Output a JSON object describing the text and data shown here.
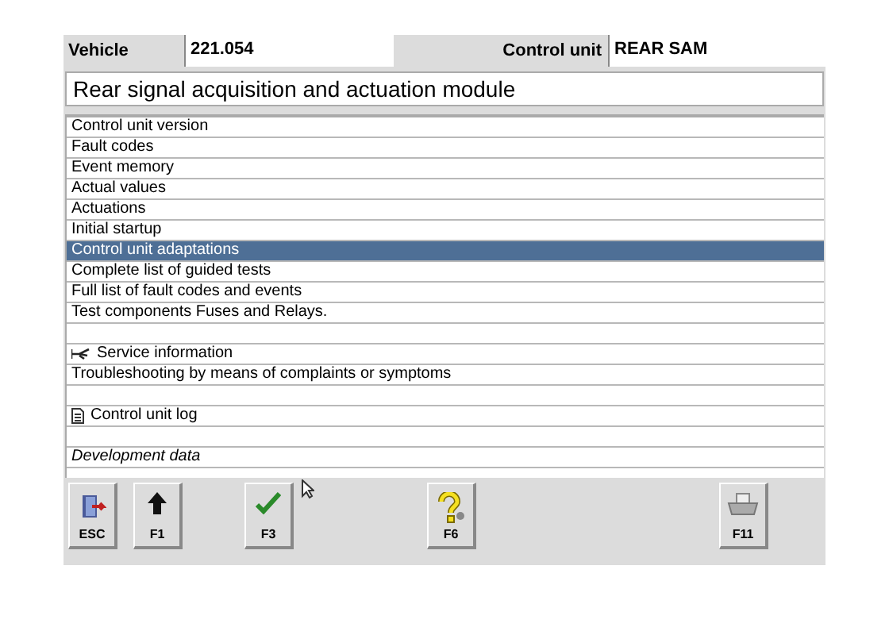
{
  "header": {
    "vehicle_label": "Vehicle",
    "vehicle_value": "221.054",
    "control_unit_label": "Control unit",
    "control_unit_value": "REAR SAM"
  },
  "title": "Rear signal acquisition and actuation module",
  "menu": [
    {
      "kind": "item",
      "label": "Control unit version",
      "selected": false
    },
    {
      "kind": "item",
      "label": "Fault codes",
      "selected": false
    },
    {
      "kind": "item",
      "label": "Event memory",
      "selected": false
    },
    {
      "kind": "item",
      "label": "Actual values",
      "selected": false
    },
    {
      "kind": "item",
      "label": "Actuations",
      "selected": false
    },
    {
      "kind": "item",
      "label": "Initial startup",
      "selected": false
    },
    {
      "kind": "item",
      "label": "Control unit adaptations",
      "selected": true
    },
    {
      "kind": "item",
      "label": "Complete list of guided tests",
      "selected": false
    },
    {
      "kind": "item",
      "label": "Full list of fault codes and events",
      "selected": false
    },
    {
      "kind": "item",
      "label": "Test components Fuses and Relays.",
      "selected": false
    },
    {
      "kind": "spacer"
    },
    {
      "kind": "service",
      "label": "Service information",
      "selected": false
    },
    {
      "kind": "item",
      "label": "Troubleshooting by means of complaints or symptoms",
      "selected": false
    },
    {
      "kind": "spacer"
    },
    {
      "kind": "log",
      "label": "Control unit log",
      "selected": false
    },
    {
      "kind": "spacer"
    },
    {
      "kind": "italic",
      "label": "Development data",
      "selected": false
    }
  ],
  "buttons": [
    {
      "kind": "exit",
      "key": "ESC"
    },
    {
      "kind": "up",
      "key": "F1"
    },
    {
      "kind": "check",
      "key": "F3"
    },
    {
      "kind": "help",
      "key": "F6"
    },
    {
      "kind": "print",
      "key": "F11"
    }
  ]
}
